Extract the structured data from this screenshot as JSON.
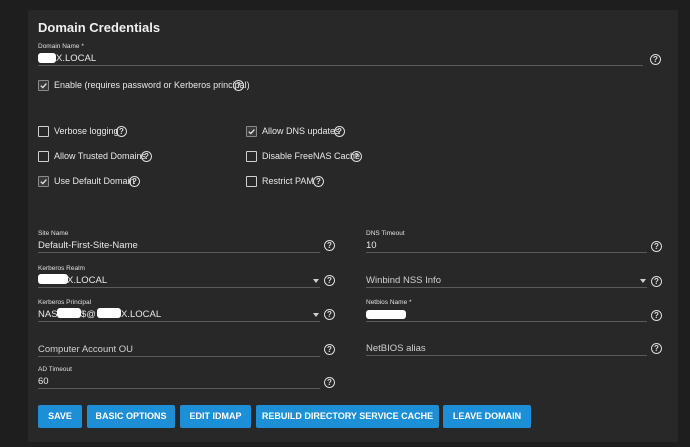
{
  "section_title": "Domain Credentials",
  "domain_name": {
    "label": "Domain Name *",
    "value": "X.LOCAL"
  },
  "enable": {
    "label": "Enable (requires password or Kerberos principal)",
    "checked": true
  },
  "options": [
    {
      "label": "Verbose logging",
      "checked": false
    },
    {
      "label": "Allow Trusted Domains",
      "checked": false
    },
    {
      "label": "Use Default Domain",
      "checked": true
    },
    {
      "label": "Allow DNS updates",
      "checked": true
    },
    {
      "label": "Disable FreeNAS Cache",
      "checked": false
    },
    {
      "label": "Restrict PAM",
      "checked": false
    }
  ],
  "fields": {
    "site_name": {
      "label": "Site Name",
      "value": "Default-First-Site-Name"
    },
    "kerberos_realm": {
      "label": "Kerberos Realm",
      "value": "X.LOCAL"
    },
    "kerberos_principal": {
      "label": "Kerberos Principal",
      "value_prefix": "NAS",
      "value_middle": "$@",
      "value_suffix": "X.LOCAL"
    },
    "computer_account_ou": {
      "placeholder": "Computer Account OU"
    },
    "ad_timeout": {
      "label": "AD Timeout",
      "value": "60"
    },
    "dns_timeout": {
      "label": "DNS Timeout",
      "value": "10"
    },
    "winbind_nss_info": {
      "placeholder": "Winbind NSS Info"
    },
    "netbios_name": {
      "label": "Netbios Name *"
    },
    "netbios_alias": {
      "placeholder": "NetBIOS alias"
    }
  },
  "help_glyph": "?",
  "buttons": {
    "save": "SAVE",
    "basic_options": "BASIC OPTIONS",
    "edit_idmap": "EDIT IDMAP",
    "rebuild_cache": "REBUILD DIRECTORY SERVICE CACHE",
    "leave_domain": "LEAVE DOMAIN"
  },
  "colors": {
    "accent": "#1d8fd6",
    "card": "#282828",
    "background": "#1e1e1e"
  }
}
